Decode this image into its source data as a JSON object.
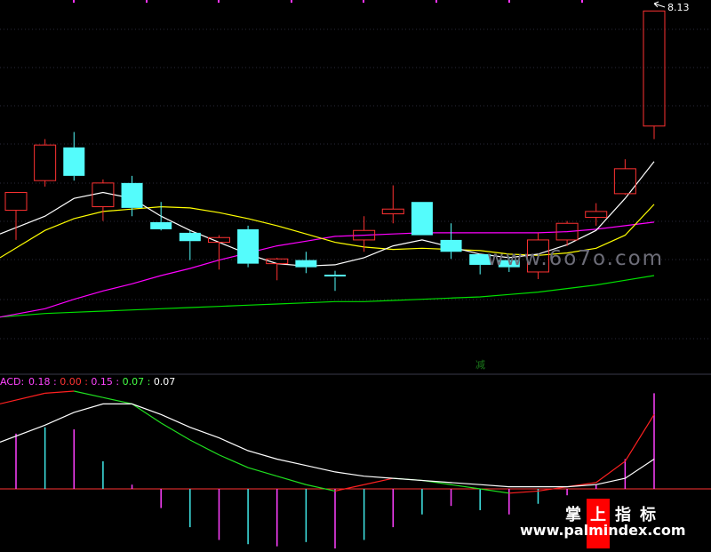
{
  "chart_data": {
    "type": "candlestick",
    "price_label": "8.13",
    "price_ylim": [
      5.6,
      8.2
    ],
    "candles": [
      {
        "o": 6.45,
        "h": 6.6,
        "l": 6.2,
        "c": 6.6,
        "color": "red"
      },
      {
        "o": 6.7,
        "h": 7.05,
        "l": 6.65,
        "c": 7.0,
        "color": "red"
      },
      {
        "o": 6.98,
        "h": 7.11,
        "l": 6.7,
        "c": 6.74,
        "color": "cyan"
      },
      {
        "o": 6.48,
        "h": 6.71,
        "l": 6.36,
        "c": 6.68,
        "color": "red"
      },
      {
        "o": 6.68,
        "h": 6.74,
        "l": 6.4,
        "c": 6.47,
        "color": "cyan"
      },
      {
        "o": 6.35,
        "h": 6.52,
        "l": 6.28,
        "c": 6.29,
        "color": "cyan"
      },
      {
        "o": 6.26,
        "h": 6.28,
        "l": 6.03,
        "c": 6.19,
        "color": "cyan"
      },
      {
        "o": 6.18,
        "h": 6.24,
        "l": 5.95,
        "c": 6.22,
        "color": "red"
      },
      {
        "o": 6.29,
        "h": 6.32,
        "l": 5.97,
        "c": 6.0,
        "color": "cyan"
      },
      {
        "o": 6.0,
        "h": 6.05,
        "l": 5.86,
        "c": 6.04,
        "color": "red"
      },
      {
        "o": 6.03,
        "h": 6.1,
        "l": 5.92,
        "c": 5.97,
        "color": "cyan"
      },
      {
        "o": 5.9,
        "h": 5.94,
        "l": 5.77,
        "c": 5.9,
        "color": "cyan-flat"
      },
      {
        "o": 6.2,
        "h": 6.4,
        "l": 6.1,
        "c": 6.28,
        "color": "red"
      },
      {
        "o": 6.42,
        "h": 6.66,
        "l": 6.34,
        "c": 6.46,
        "color": "red"
      },
      {
        "o": 6.52,
        "h": 6.52,
        "l": 6.24,
        "c": 6.24,
        "color": "cyan"
      },
      {
        "o": 6.2,
        "h": 6.34,
        "l": 6.04,
        "c": 6.1,
        "color": "cyan"
      },
      {
        "o": 6.08,
        "h": 6.08,
        "l": 5.91,
        "c": 5.99,
        "color": "cyan"
      },
      {
        "o": 6.03,
        "h": 6.06,
        "l": 5.93,
        "c": 5.97,
        "color": "cyan"
      },
      {
        "o": 5.93,
        "h": 6.26,
        "l": 5.87,
        "c": 6.2,
        "color": "red"
      },
      {
        "o": 6.2,
        "h": 6.36,
        "l": 6.15,
        "c": 6.34,
        "color": "red"
      },
      {
        "o": 6.39,
        "h": 6.51,
        "l": 6.32,
        "c": 6.44,
        "color": "red"
      },
      {
        "o": 6.59,
        "h": 6.88,
        "l": 6.58,
        "c": 6.8,
        "color": "red"
      },
      {
        "o": 7.16,
        "h": 8.13,
        "l": 7.05,
        "c": 8.13,
        "color": "red"
      }
    ],
    "ma_white": [
      6.25,
      6.4,
      6.55,
      6.6,
      6.55,
      6.4,
      6.28,
      6.18,
      6.08,
      6.0,
      5.98,
      5.99,
      6.05,
      6.15,
      6.2,
      6.14,
      6.08,
      6.05,
      6.08,
      6.16,
      6.28,
      6.55,
      6.86
    ],
    "ma_yellow": [
      6.05,
      6.28,
      6.38,
      6.44,
      6.46,
      6.48,
      6.47,
      6.43,
      6.38,
      6.32,
      6.25,
      6.18,
      6.14,
      6.12,
      6.13,
      6.12,
      6.11,
      6.08,
      6.07,
      6.09,
      6.13,
      6.24,
      6.5
    ],
    "ma_magenta": [
      5.55,
      5.62,
      5.7,
      5.77,
      5.83,
      5.9,
      5.96,
      6.03,
      6.09,
      6.15,
      6.19,
      6.23,
      6.24,
      6.25,
      6.26,
      6.26,
      6.26,
      6.26,
      6.26,
      6.27,
      6.29,
      6.32,
      6.35
    ],
    "ma_green": [
      5.55,
      5.58,
      5.59,
      5.6,
      5.61,
      5.62,
      5.63,
      5.64,
      5.65,
      5.66,
      5.67,
      5.68,
      5.68,
      5.69,
      5.7,
      5.71,
      5.72,
      5.74,
      5.76,
      5.79,
      5.82,
      5.86,
      5.9
    ],
    "signal_label": "减",
    "macd": {
      "label_prefix": "ACD:",
      "values_text": [
        {
          "text": "0.18",
          "color": "#ff44ff"
        },
        {
          "text": "0.00",
          "color": "#ff3333"
        },
        {
          "text": "0.15",
          "color": "#ff44ff"
        },
        {
          "text": "0.07",
          "color": "#44ff44"
        },
        {
          "text": "0.07",
          "color": "#ffffff"
        }
      ],
      "ylim": [
        -0.28,
        0.46
      ],
      "hist": [
        0.26,
        0.29,
        0.28,
        0.13,
        0.02,
        -0.09,
        -0.18,
        -0.24,
        -0.26,
        -0.27,
        -0.25,
        -0.28,
        -0.24,
        -0.18,
        -0.12,
        -0.08,
        -0.1,
        -0.12,
        -0.07,
        -0.03,
        0.02,
        0.14,
        0.45
      ],
      "dif": [
        0.4,
        0.45,
        0.46,
        0.43,
        0.4,
        0.31,
        0.23,
        0.16,
        0.1,
        0.06,
        0.02,
        -0.01,
        0.02,
        0.05,
        0.04,
        0.02,
        0.0,
        -0.02,
        -0.01,
        0.01,
        0.03,
        0.13,
        0.35
      ],
      "dea": [
        0.22,
        0.3,
        0.36,
        0.4,
        0.4,
        0.35,
        0.29,
        0.24,
        0.18,
        0.14,
        0.11,
        0.08,
        0.06,
        0.05,
        0.04,
        0.03,
        0.02,
        0.01,
        0.01,
        0.01,
        0.02,
        0.05,
        0.14
      ]
    },
    "watermarks": {
      "site1": "www.6o7o.com",
      "brand_chars": [
        "掌",
        "上",
        "指",
        "标"
      ],
      "site2": "www.palmindex.com"
    },
    "colors": {
      "up": "#ff3232",
      "down": "#54fcfc",
      "ma_white": "#ffffff",
      "ma_yellow": "#ffff00",
      "ma_magenta": "#ff00ff",
      "ma_green": "#00e000",
      "grid": "#2a2a3a",
      "bg": "#000000"
    }
  }
}
